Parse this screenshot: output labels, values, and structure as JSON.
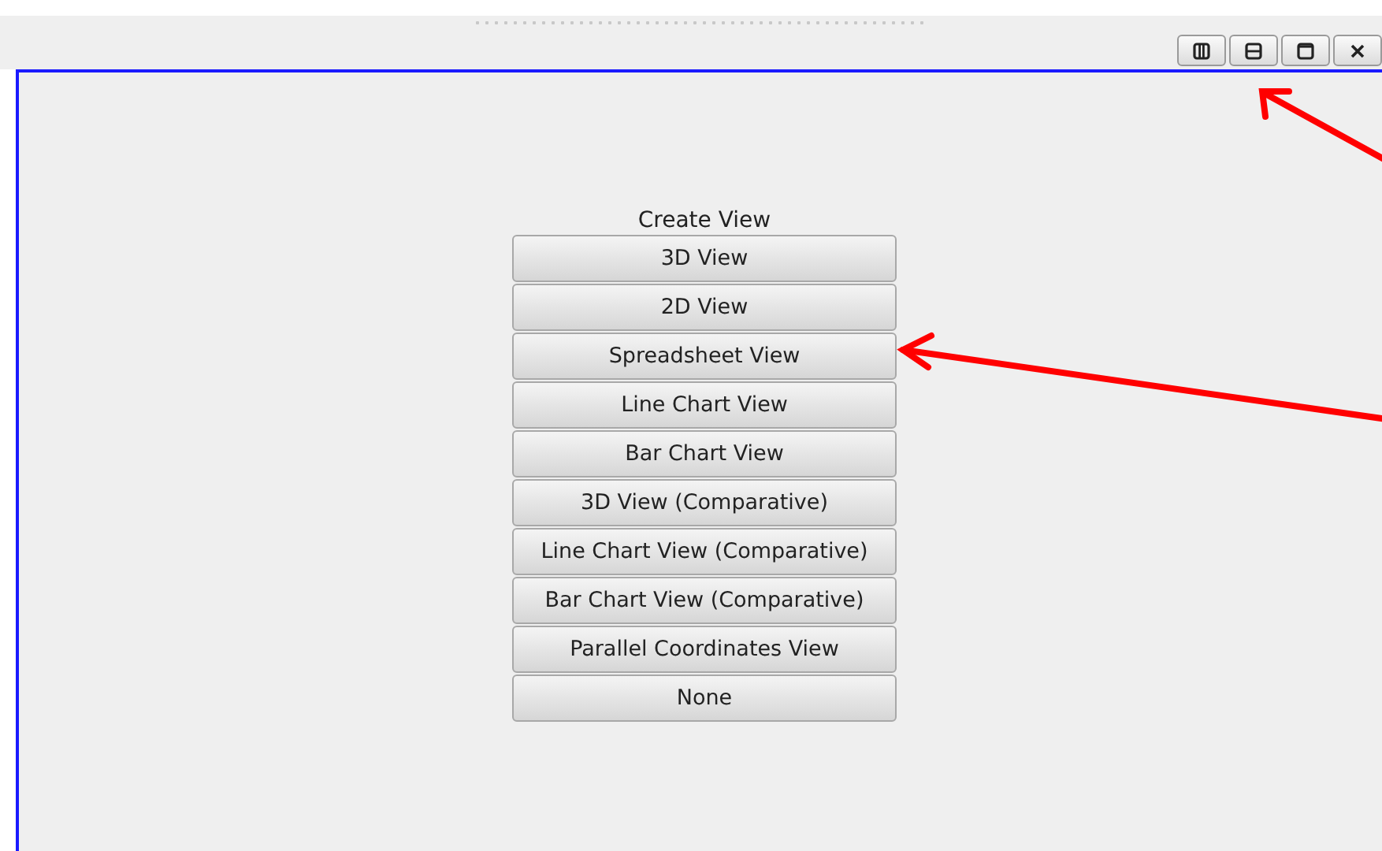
{
  "create_view": {
    "title": "Create View",
    "buttons": [
      "3D View",
      "2D View",
      "Spreadsheet View",
      "Line Chart View",
      "Bar Chart View",
      "3D View (Comparative)",
      "Line Chart View (Comparative)",
      "Bar Chart View (Comparative)",
      "Parallel Coordinates View",
      "None"
    ]
  }
}
